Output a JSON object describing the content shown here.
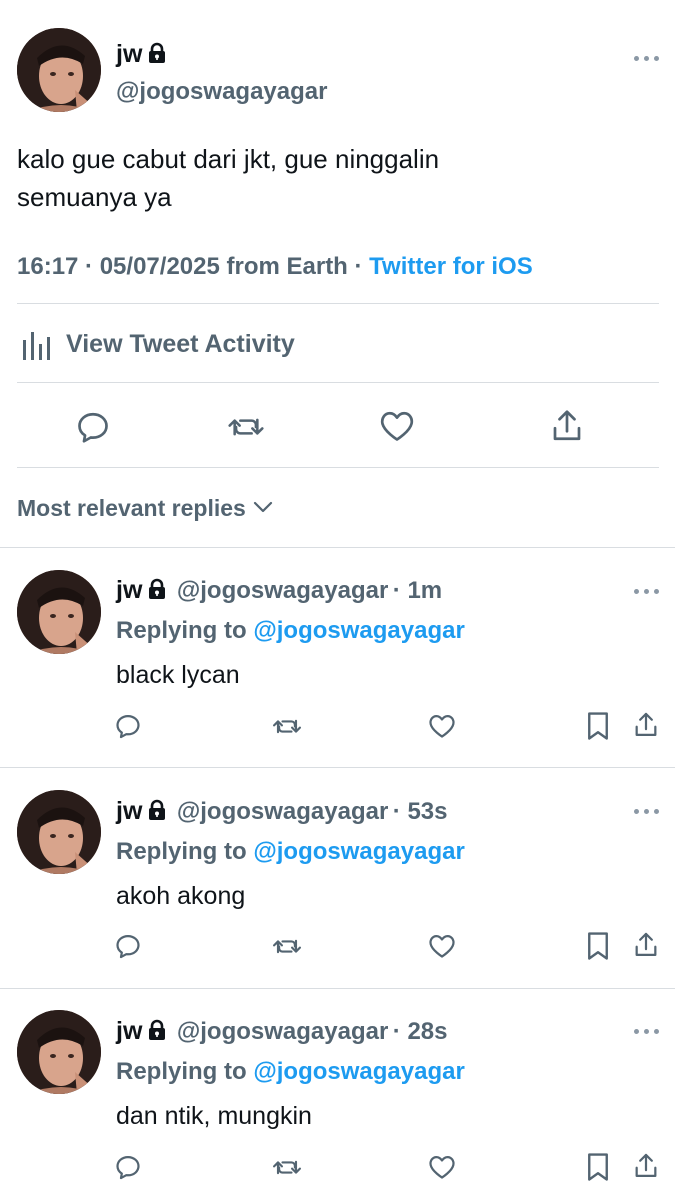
{
  "main_tweet": {
    "name": "jw",
    "handle": "@jogoswagayagar",
    "text_line1": "kalo gue cabut dari jkt, gue ninggalin",
    "text_line2": "semuanya ya",
    "timestamp": "16:17 · 05/07/2025 from Earth",
    "separator": " · ",
    "source": "Twitter for iOS",
    "activity_label": "View Tweet Activity"
  },
  "replies_sort_label": "Most relevant replies",
  "replies": [
    {
      "name": "jw",
      "handle": "@jogoswagayagar",
      "time": "· 1m",
      "replying_prefix": "Replying to",
      "replying_to": "@jogoswagayagar",
      "text": "black lycan"
    },
    {
      "name": "jw",
      "handle": "@jogoswagayagar",
      "time": "· 53s",
      "replying_prefix": "Replying to",
      "replying_to": "@jogoswagayagar",
      "text": "akoh akong"
    },
    {
      "name": "jw",
      "handle": "@jogoswagayagar",
      "time": "· 28s",
      "replying_prefix": "Replying to",
      "replying_to": "@jogoswagayagar",
      "text": "dan ntik, mungkin"
    }
  ],
  "colors": {
    "text": "#0f1419",
    "secondary": "#536471",
    "accent": "#1d9bf0",
    "divider": "#d9dde1"
  },
  "icons": [
    "lock-icon",
    "more-icon",
    "reply-icon",
    "retweet-icon",
    "like-icon",
    "share-icon",
    "bookmark-icon",
    "analytics-icon",
    "chevron-down-icon"
  ]
}
